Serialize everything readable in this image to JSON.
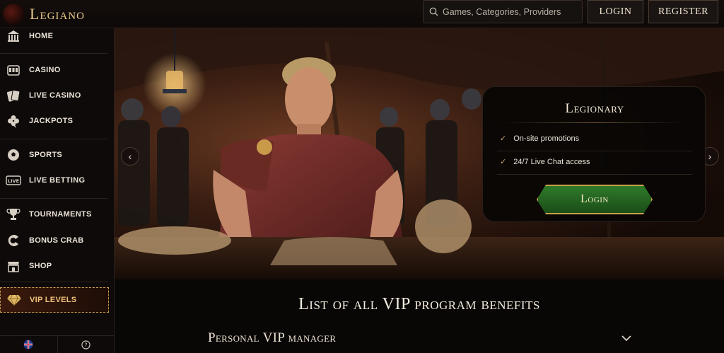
{
  "brand": {
    "logo_text": "Legiano"
  },
  "search": {
    "placeholder": "Games, Categories, Providers"
  },
  "header": {
    "login_label": "Login",
    "register_label": "Register"
  },
  "sidebar": {
    "items": [
      {
        "label": "HOME",
        "icon": "home-icon"
      },
      {
        "label": "CASINO",
        "icon": "slot-machine-icon"
      },
      {
        "label": "LIVE CASINO",
        "icon": "cards-icon"
      },
      {
        "label": "JACKPOTS",
        "icon": "clover-icon"
      },
      {
        "label": "SPORTS",
        "icon": "ball-icon"
      },
      {
        "label": "LIVE BETTING",
        "icon": "live-icon"
      },
      {
        "label": "TOURNAMENTS",
        "icon": "trophy-icon"
      },
      {
        "label": "BONUS CRAB",
        "icon": "claw-icon"
      },
      {
        "label": "SHOP",
        "icon": "shop-icon"
      },
      {
        "label": "VIP LEVELS",
        "icon": "diamond-icon"
      }
    ]
  },
  "hero": {
    "card": {
      "title": "Legionary",
      "benefits": [
        "On-site promotions",
        "24/7 Live Chat access"
      ],
      "login_label": "Login"
    }
  },
  "content": {
    "section_title": "List of all VIP program benefits",
    "accordion_title": "Personal VIP manager"
  },
  "colors": {
    "accent_gold": "#c9a56a",
    "login_green": "#2f7a2a",
    "background": "#0b0807"
  }
}
